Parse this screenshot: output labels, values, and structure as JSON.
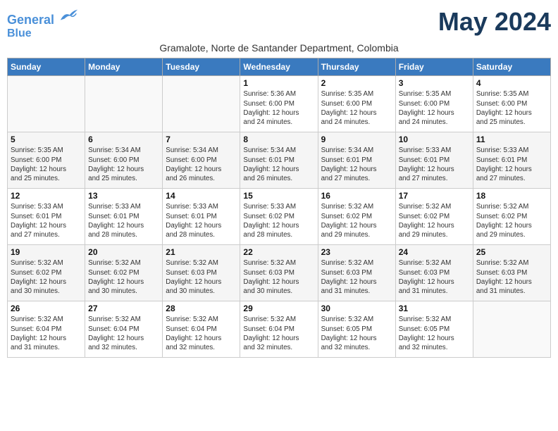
{
  "header": {
    "logo_line1": "General",
    "logo_line2": "Blue",
    "month_title": "May 2024",
    "subtitle": "Gramalote, Norte de Santander Department, Colombia"
  },
  "days_of_week": [
    "Sunday",
    "Monday",
    "Tuesday",
    "Wednesday",
    "Thursday",
    "Friday",
    "Saturday"
  ],
  "weeks": [
    [
      {
        "day": "",
        "info": ""
      },
      {
        "day": "",
        "info": ""
      },
      {
        "day": "",
        "info": ""
      },
      {
        "day": "1",
        "info": "Sunrise: 5:36 AM\nSunset: 6:00 PM\nDaylight: 12 hours\nand 24 minutes."
      },
      {
        "day": "2",
        "info": "Sunrise: 5:35 AM\nSunset: 6:00 PM\nDaylight: 12 hours\nand 24 minutes."
      },
      {
        "day": "3",
        "info": "Sunrise: 5:35 AM\nSunset: 6:00 PM\nDaylight: 12 hours\nand 24 minutes."
      },
      {
        "day": "4",
        "info": "Sunrise: 5:35 AM\nSunset: 6:00 PM\nDaylight: 12 hours\nand 25 minutes."
      }
    ],
    [
      {
        "day": "5",
        "info": "Sunrise: 5:35 AM\nSunset: 6:00 PM\nDaylight: 12 hours\nand 25 minutes."
      },
      {
        "day": "6",
        "info": "Sunrise: 5:34 AM\nSunset: 6:00 PM\nDaylight: 12 hours\nand 25 minutes."
      },
      {
        "day": "7",
        "info": "Sunrise: 5:34 AM\nSunset: 6:00 PM\nDaylight: 12 hours\nand 26 minutes."
      },
      {
        "day": "8",
        "info": "Sunrise: 5:34 AM\nSunset: 6:01 PM\nDaylight: 12 hours\nand 26 minutes."
      },
      {
        "day": "9",
        "info": "Sunrise: 5:34 AM\nSunset: 6:01 PM\nDaylight: 12 hours\nand 27 minutes."
      },
      {
        "day": "10",
        "info": "Sunrise: 5:33 AM\nSunset: 6:01 PM\nDaylight: 12 hours\nand 27 minutes."
      },
      {
        "day": "11",
        "info": "Sunrise: 5:33 AM\nSunset: 6:01 PM\nDaylight: 12 hours\nand 27 minutes."
      }
    ],
    [
      {
        "day": "12",
        "info": "Sunrise: 5:33 AM\nSunset: 6:01 PM\nDaylight: 12 hours\nand 27 minutes."
      },
      {
        "day": "13",
        "info": "Sunrise: 5:33 AM\nSunset: 6:01 PM\nDaylight: 12 hours\nand 28 minutes."
      },
      {
        "day": "14",
        "info": "Sunrise: 5:33 AM\nSunset: 6:01 PM\nDaylight: 12 hours\nand 28 minutes."
      },
      {
        "day": "15",
        "info": "Sunrise: 5:33 AM\nSunset: 6:02 PM\nDaylight: 12 hours\nand 28 minutes."
      },
      {
        "day": "16",
        "info": "Sunrise: 5:32 AM\nSunset: 6:02 PM\nDaylight: 12 hours\nand 29 minutes."
      },
      {
        "day": "17",
        "info": "Sunrise: 5:32 AM\nSunset: 6:02 PM\nDaylight: 12 hours\nand 29 minutes."
      },
      {
        "day": "18",
        "info": "Sunrise: 5:32 AM\nSunset: 6:02 PM\nDaylight: 12 hours\nand 29 minutes."
      }
    ],
    [
      {
        "day": "19",
        "info": "Sunrise: 5:32 AM\nSunset: 6:02 PM\nDaylight: 12 hours\nand 30 minutes."
      },
      {
        "day": "20",
        "info": "Sunrise: 5:32 AM\nSunset: 6:02 PM\nDaylight: 12 hours\nand 30 minutes."
      },
      {
        "day": "21",
        "info": "Sunrise: 5:32 AM\nSunset: 6:03 PM\nDaylight: 12 hours\nand 30 minutes."
      },
      {
        "day": "22",
        "info": "Sunrise: 5:32 AM\nSunset: 6:03 PM\nDaylight: 12 hours\nand 30 minutes."
      },
      {
        "day": "23",
        "info": "Sunrise: 5:32 AM\nSunset: 6:03 PM\nDaylight: 12 hours\nand 31 minutes."
      },
      {
        "day": "24",
        "info": "Sunrise: 5:32 AM\nSunset: 6:03 PM\nDaylight: 12 hours\nand 31 minutes."
      },
      {
        "day": "25",
        "info": "Sunrise: 5:32 AM\nSunset: 6:03 PM\nDaylight: 12 hours\nand 31 minutes."
      }
    ],
    [
      {
        "day": "26",
        "info": "Sunrise: 5:32 AM\nSunset: 6:04 PM\nDaylight: 12 hours\nand 31 minutes."
      },
      {
        "day": "27",
        "info": "Sunrise: 5:32 AM\nSunset: 6:04 PM\nDaylight: 12 hours\nand 32 minutes."
      },
      {
        "day": "28",
        "info": "Sunrise: 5:32 AM\nSunset: 6:04 PM\nDaylight: 12 hours\nand 32 minutes."
      },
      {
        "day": "29",
        "info": "Sunrise: 5:32 AM\nSunset: 6:04 PM\nDaylight: 12 hours\nand 32 minutes."
      },
      {
        "day": "30",
        "info": "Sunrise: 5:32 AM\nSunset: 6:05 PM\nDaylight: 12 hours\nand 32 minutes."
      },
      {
        "day": "31",
        "info": "Sunrise: 5:32 AM\nSunset: 6:05 PM\nDaylight: 12 hours\nand 32 minutes."
      },
      {
        "day": "",
        "info": ""
      }
    ]
  ]
}
